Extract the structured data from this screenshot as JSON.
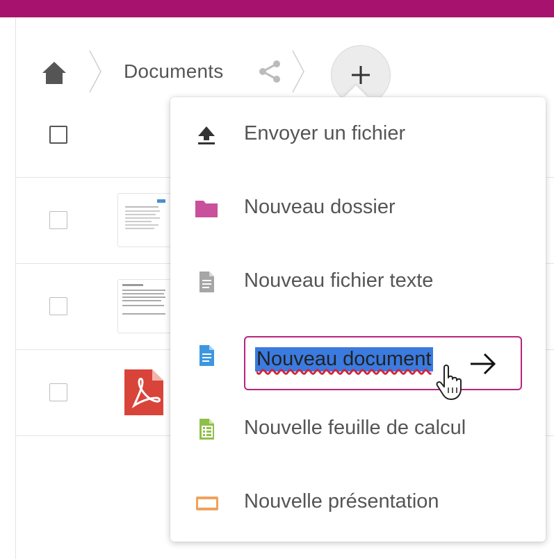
{
  "breadcrumb": {
    "home_icon": "home-icon",
    "current_folder": "Documents",
    "share_icon": "share-icon",
    "add_label": "+"
  },
  "file_list": {
    "rows": [
      {
        "thumbnail": "document-preview"
      },
      {
        "thumbnail": "text-preview"
      },
      {
        "thumbnail": "pdf-icon"
      }
    ]
  },
  "new_menu": {
    "items": [
      {
        "label": "Envoyer un fichier",
        "icon": "upload-icon"
      },
      {
        "label": "Nouveau dossier",
        "icon": "folder-icon"
      },
      {
        "label": "Nouveau fichier texte",
        "icon": "text-file-icon"
      },
      {
        "label": "Nouveau document",
        "icon": "document-icon",
        "input_value": "Nouveau document"
      },
      {
        "label": "Nouvelle feuille de calcul",
        "icon": "spreadsheet-icon"
      },
      {
        "label": "Nouvelle présentation",
        "icon": "presentation-icon"
      }
    ]
  },
  "colors": {
    "top_bar": "#a8126f",
    "input_border": "#b8237c",
    "selection": "#3b7be0",
    "folder": "#c9509a",
    "document": "#3d97e0",
    "spreadsheet": "#8fbf4a",
    "presentation": "#f0a25c",
    "text_file": "#a6a6a6"
  }
}
